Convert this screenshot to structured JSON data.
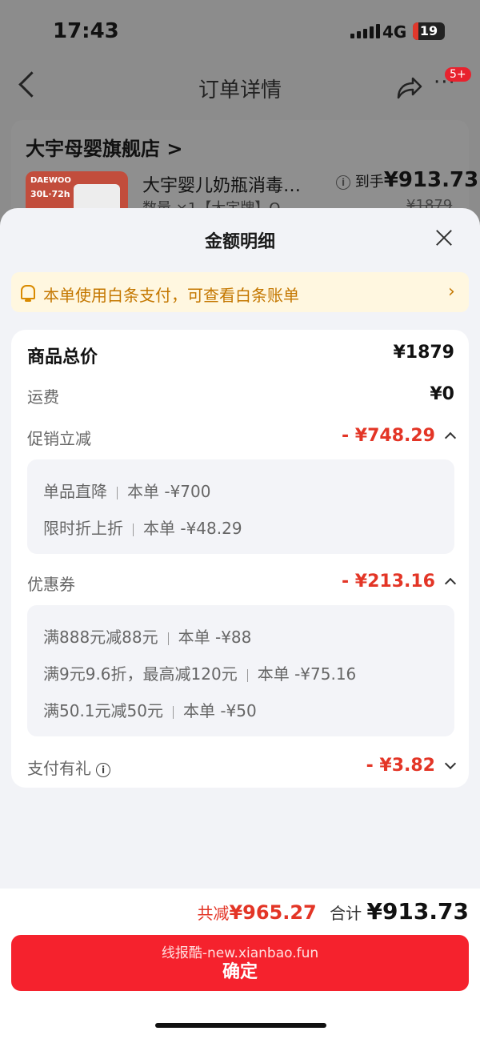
{
  "status": {
    "time": "17:43",
    "network": "4G",
    "battery": "19"
  },
  "nav": {
    "title": "订单详情",
    "badge": "5+"
  },
  "background_order": {
    "store_name": "大宇母婴旗舰店 >",
    "product_title": "大宇婴儿奶瓶消毒…",
    "product_sub": "数量 ×1【大宇牌】Q",
    "thumb_brand": "DAEWOO",
    "thumb_spec": "30L·72h",
    "price_prefix": "到手",
    "price_value": "¥913.73",
    "price_original": "¥1879"
  },
  "sheet": {
    "title": "金额明细",
    "notice": "本单使用白条支付，可查看白条账单",
    "notice_arrow": "›",
    "rows": {
      "total": {
        "label": "商品总价",
        "value": "¥1879"
      },
      "shipping": {
        "label": "运费",
        "value": "¥0"
      },
      "promo": {
        "label": "促销立减",
        "value": "- ¥748.29"
      },
      "coupon": {
        "label": "优惠券",
        "value": "- ¥213.16"
      },
      "pay_gift": {
        "label": "支付有礼",
        "value": "- ¥3.82"
      }
    },
    "promo_items": [
      {
        "name": "单品直降",
        "detail": "本单 -¥700"
      },
      {
        "name": "限时折上折",
        "detail": "本单 -¥48.29"
      }
    ],
    "coupon_items": [
      {
        "name": "满888元减88元",
        "detail": "本单 -¥88"
      },
      {
        "name": "满9元9.6折，最高减120元",
        "detail": "本单 -¥75.16"
      },
      {
        "name": "满50.1元减50元",
        "detail": "本单 -¥50"
      }
    ]
  },
  "bottom": {
    "saved_label": "共减",
    "saved_value": "¥965.27",
    "sum_label": "合计",
    "sum_value": "¥913.73",
    "watermark": "线报酷-new.xianbao.fun",
    "confirm": "确定"
  }
}
